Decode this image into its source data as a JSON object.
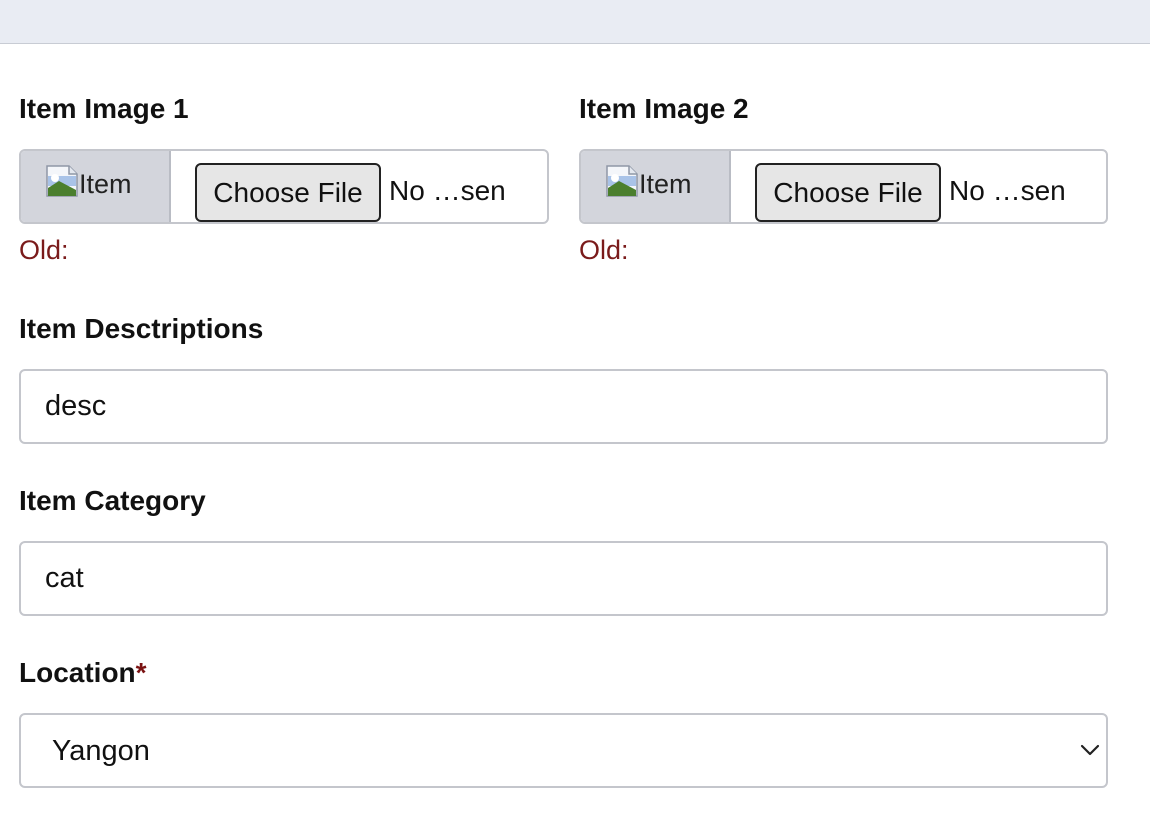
{
  "image1": {
    "label": "Item Image 1",
    "img_alt": "Item",
    "button_label": "Choose File",
    "file_status": "No …sen",
    "old_label": "Old:"
  },
  "image2": {
    "label": "Item Image 2",
    "img_alt": "Item",
    "button_label": "Choose File",
    "file_status": "No …sen",
    "old_label": "Old:"
  },
  "description": {
    "label": "Item Desctriptions",
    "value": "desc"
  },
  "category": {
    "label": "Item Category",
    "value": "cat"
  },
  "location": {
    "label": "Location",
    "required_mark": "*",
    "selected": "Yangon"
  },
  "icons": {
    "broken_image": "broken-image-icon",
    "dropdown": "chevron-down-icon"
  },
  "colors": {
    "topbar": "#e9ecf3",
    "input_addon": "#d3d5dc",
    "old_label": "#7a1b1b",
    "required": "#7a1212",
    "border": "#c4c6cc"
  }
}
